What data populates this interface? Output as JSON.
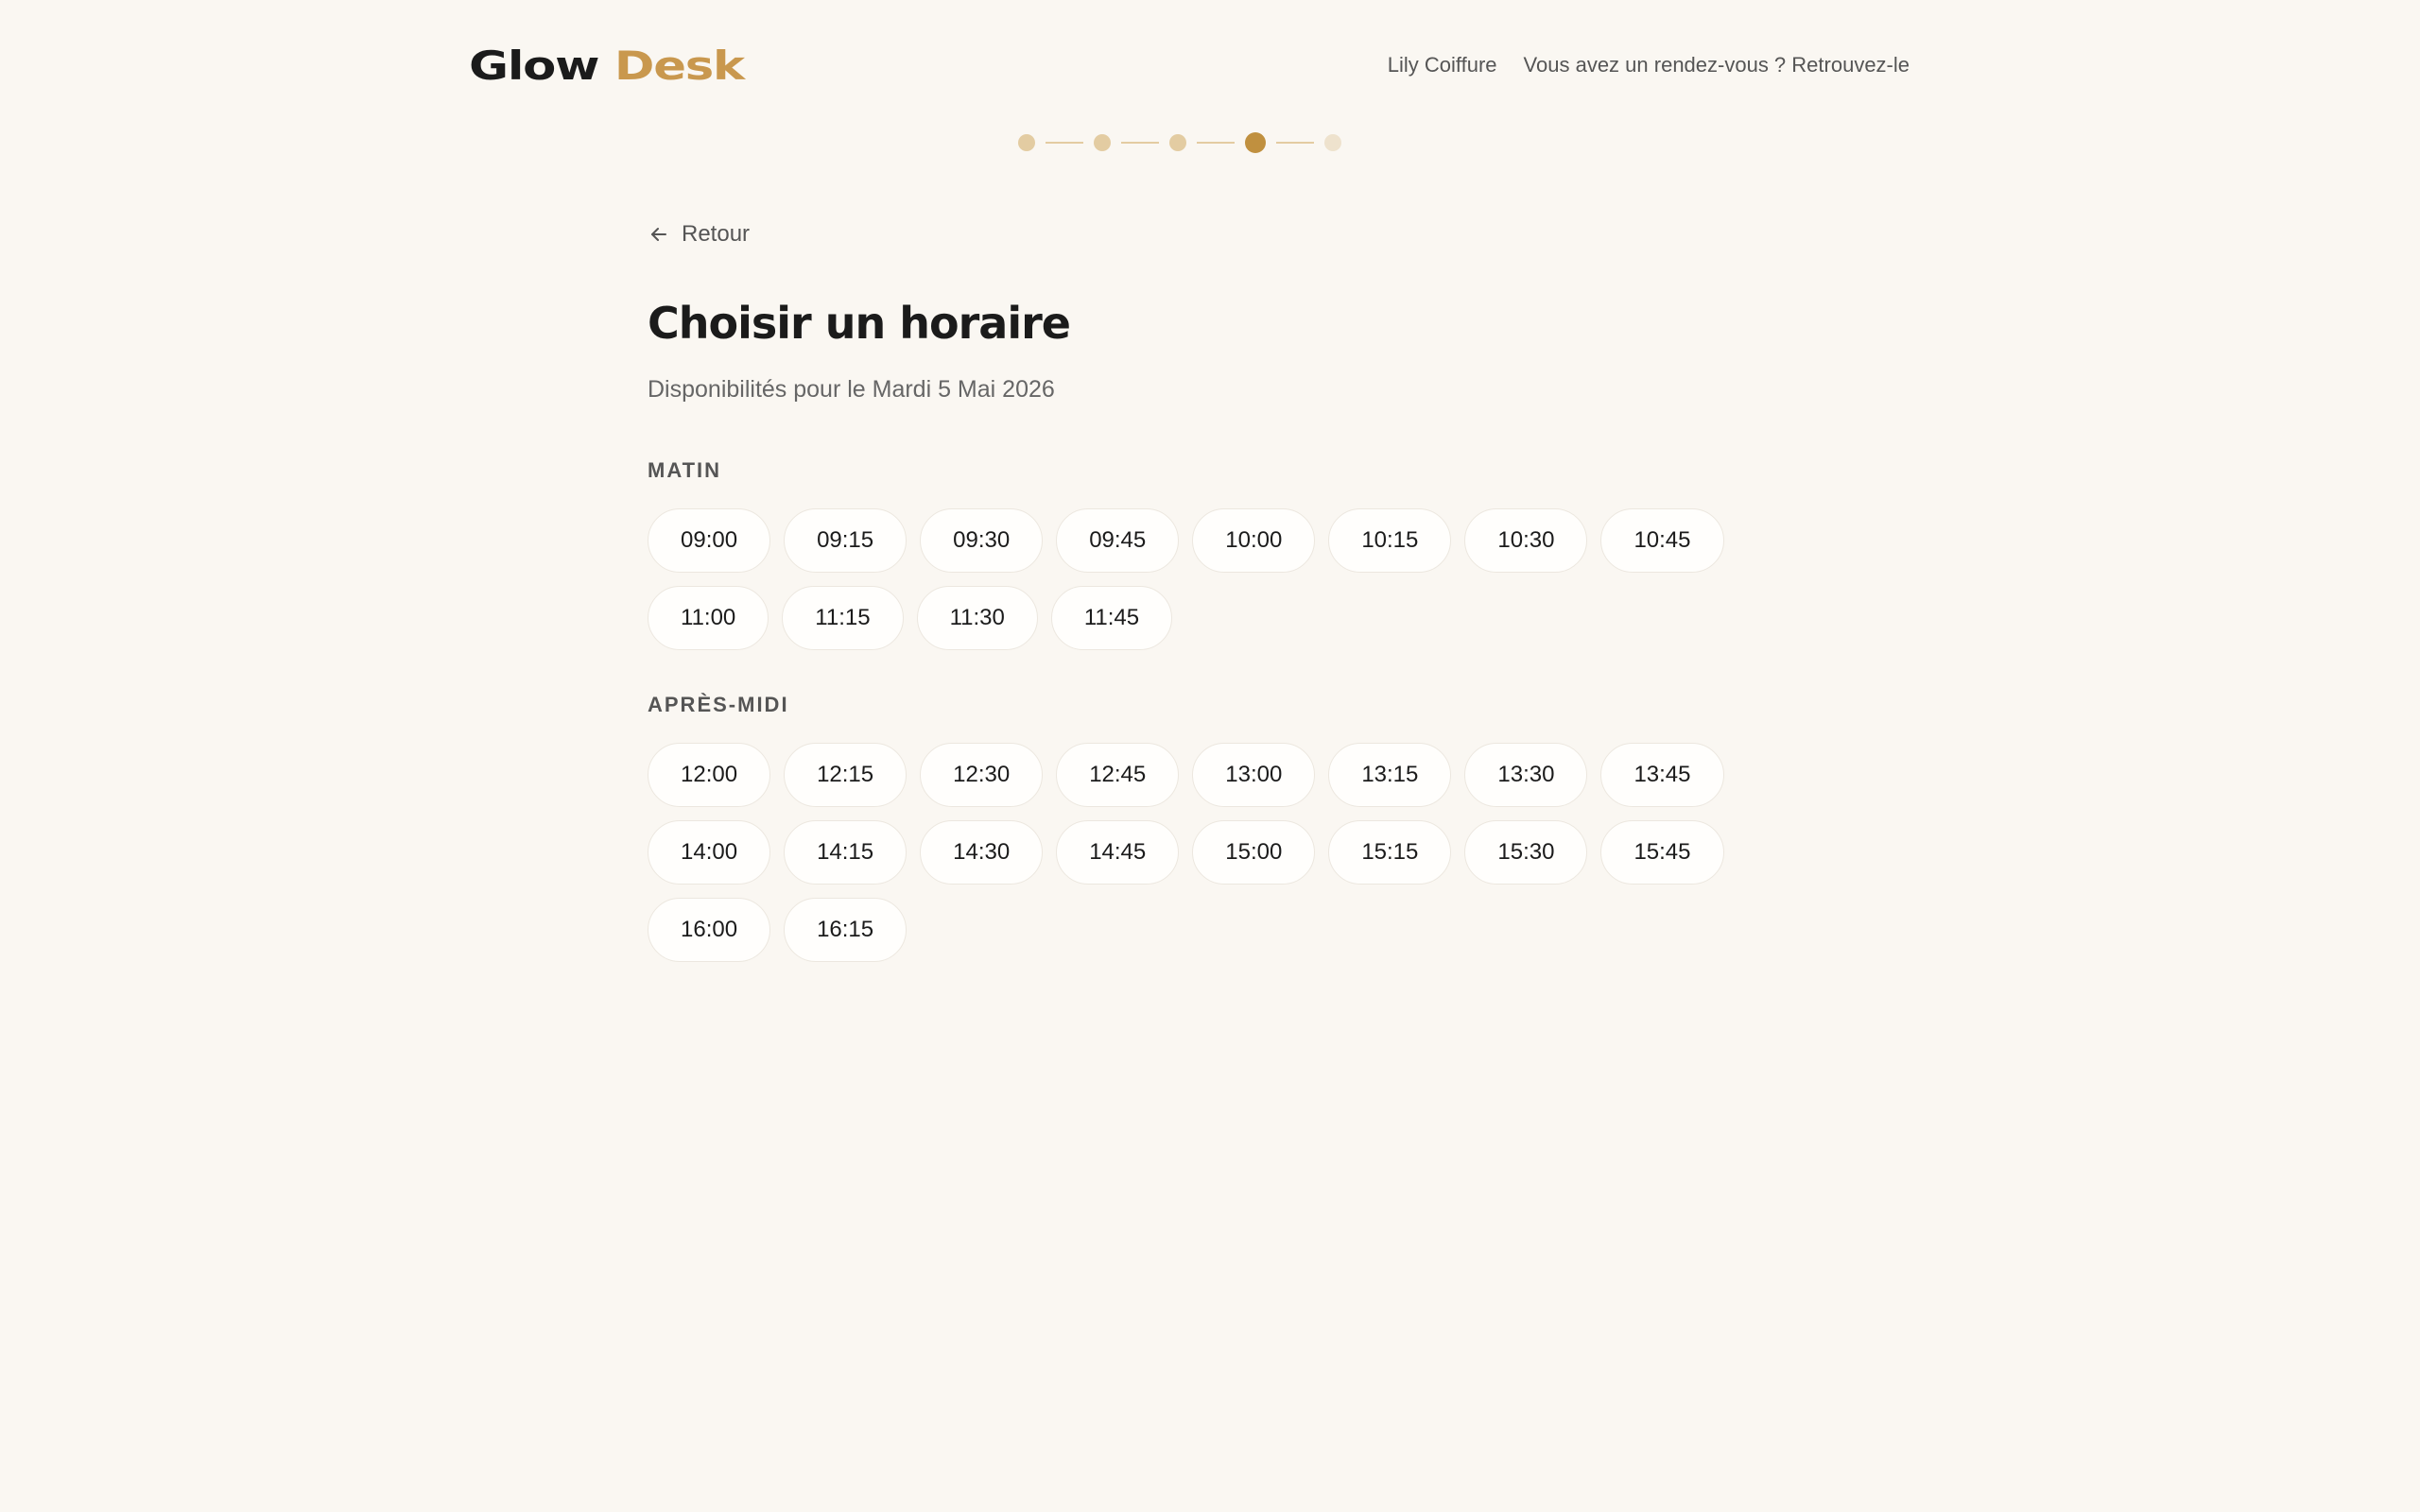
{
  "brand": {
    "part1": "Glow",
    "part2": "Desk",
    "accent": "#c9984e"
  },
  "nav": {
    "salon": "Lily Coiffure",
    "find_appointment": "Vous avez un rendez-vous ? Retrouvez-le"
  },
  "stepper": {
    "total": 5,
    "current": 4
  },
  "back_label": "Retour",
  "title": "Choisir un horaire",
  "subtitle": "Disponibilités pour le Mardi 5 Mai 2026",
  "morning": {
    "label": "MATIN",
    "slots": [
      "09:00",
      "09:15",
      "09:30",
      "09:45",
      "10:00",
      "10:15",
      "10:30",
      "10:45",
      "11:00",
      "11:15",
      "11:30",
      "11:45"
    ]
  },
  "afternoon": {
    "label": "APRÈS-MIDI",
    "slots": [
      "12:00",
      "12:15",
      "12:30",
      "12:45",
      "13:00",
      "13:15",
      "13:30",
      "13:45",
      "14:00",
      "14:15",
      "14:30",
      "14:45",
      "15:00",
      "15:15",
      "15:30",
      "15:45",
      "16:00",
      "16:15"
    ]
  }
}
